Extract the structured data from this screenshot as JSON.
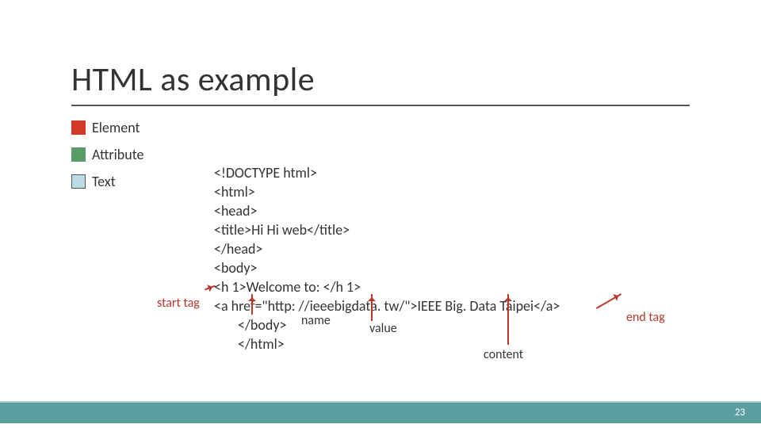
{
  "title": "HTML as example",
  "legend": {
    "element": "Element",
    "attribute": "Attribute",
    "text": "Text"
  },
  "code": {
    "l1": "<!DOCTYPE html>",
    "l2": "<html>",
    "l3": "<head>",
    "l4": "<title>Hi Hi web</title>",
    "l5": "</head>",
    "l6": "<body>",
    "l7": "<h 1>Welcome to: </h 1>",
    "l8": "<a href=\"http: //ieeebigdata. tw/\">IEEE Big. Data Taipei</a>",
    "l9": "</body>",
    "l10": "</html>"
  },
  "annotations": {
    "start_tag": "start tag",
    "end_tag": "end tag",
    "name": "name",
    "value": "value",
    "content": "content"
  },
  "page": "23"
}
